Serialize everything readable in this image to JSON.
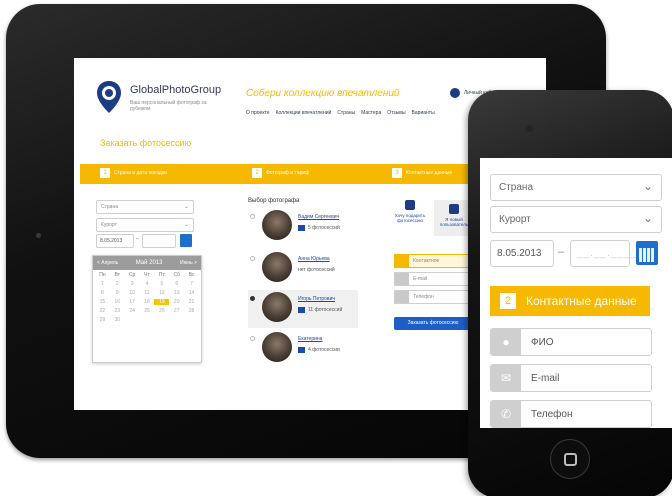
{
  "tablet": {
    "brand": "GlobalPhotoGroup",
    "tagline": "Ваш персональный фотограф за рубежом",
    "slogan": "Собери коллекцию впечатлений",
    "nav": [
      "О проекте",
      "Коллекции впечатлений",
      "Страны",
      "Мастера",
      "Отзывы",
      "Варианты"
    ],
    "account": "Личный кабинет",
    "order_title": "Заказать фотосессию",
    "steps": [
      {
        "num": "1",
        "label": "Страна и дата поездки"
      },
      {
        "num": "2",
        "label": "Фотограф и тариф"
      },
      {
        "num": "3",
        "label": "Контактные данные"
      }
    ],
    "country_placeholder": "Страна",
    "resort_placeholder": "Курорт",
    "date_value": "8.05.2013",
    "calendar": {
      "prev": "< Апрель",
      "month": "Май 2013",
      "next": "Июнь >",
      "weekdays": [
        "Пн",
        "Вт",
        "Ср",
        "Чт",
        "Пт",
        "Сб",
        "Вс"
      ],
      "days": [
        "1",
        "2",
        "3",
        "4",
        "5",
        "6",
        "7",
        "8",
        "9",
        "10",
        "11",
        "12",
        "13",
        "14",
        "15",
        "16",
        "17",
        "18",
        "19",
        "20",
        "21",
        "22",
        "23",
        "24",
        "25",
        "26",
        "27",
        "28",
        "29",
        "30"
      ],
      "selected": "19"
    },
    "photo_title": "Выбор фотографа",
    "photographers": [
      {
        "name": "Вадим Сергеевич",
        "count": "5 фотосессий"
      },
      {
        "name": "Анна Юрьева",
        "count": "нет фотосессий"
      },
      {
        "name": "Игорь Петрович",
        "count": "11 фотосессий"
      },
      {
        "name": "Екатерина",
        "count": "4 фотосессии"
      }
    ],
    "gift_label": "Хочу подарить фотосессию",
    "new_user_label": "Я новый пользователь",
    "fields": [
      "Контактное",
      "E-mail",
      "Телефон"
    ],
    "submit": "Заказать фотосессию"
  },
  "phone": {
    "country_placeholder": "Страна",
    "resort_placeholder": "Курорт",
    "date_value": "8.05.2013",
    "date_separator": "–",
    "date2_placeholder": "__.__.____",
    "step_num": "2",
    "step_label": "Контактные данные",
    "fields": [
      {
        "icon": "user-icon",
        "value": "ФИО"
      },
      {
        "icon": "mail-icon",
        "value": "E-mail"
      },
      {
        "icon": "phone-icon",
        "value": "Телефон"
      }
    ]
  },
  "colors": {
    "accent": "#f6b800",
    "brand": "#1d3c84",
    "link": "#1d4aa8"
  }
}
